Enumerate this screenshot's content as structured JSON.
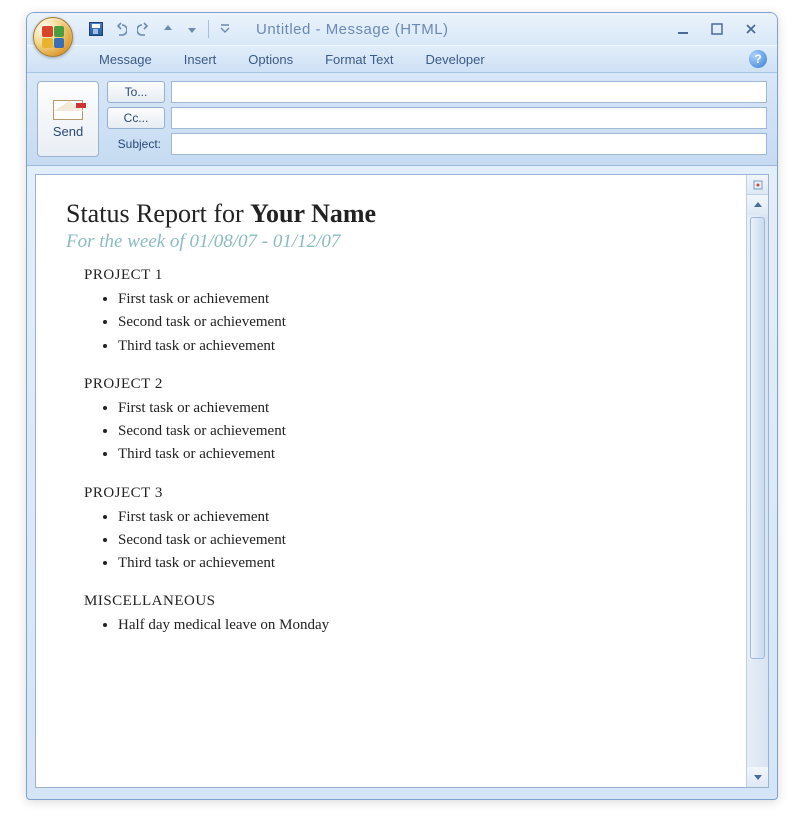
{
  "window": {
    "title": "Untitled - Message (HTML)"
  },
  "menu": {
    "items": [
      "Message",
      "Insert",
      "Options",
      "Format Text",
      "Developer"
    ]
  },
  "compose": {
    "send_label": "Send",
    "to_label": "To...",
    "cc_label": "Cc...",
    "subject_label": "Subject:",
    "to_value": "",
    "cc_value": "",
    "subject_value": ""
  },
  "document": {
    "title_prefix": "Status Report for ",
    "title_name": "Your Name",
    "subtitle": "For the week of 01/08/07 - 01/12/07",
    "sections": [
      {
        "heading": "PROJECT 1",
        "items": [
          "First task or achievement",
          "Second task or achievement",
          "Third task or achievement"
        ]
      },
      {
        "heading": "PROJECT 2",
        "items": [
          "First task or achievement",
          "Second task or achievement",
          "Third task or achievement"
        ]
      },
      {
        "heading": "PROJECT 3",
        "items": [
          "First task or achievement",
          "Second task or achievement",
          "Third task or achievement"
        ]
      },
      {
        "heading": "MISCELLANEOUS",
        "items": [
          "Half day medical leave on Monday"
        ]
      }
    ]
  }
}
